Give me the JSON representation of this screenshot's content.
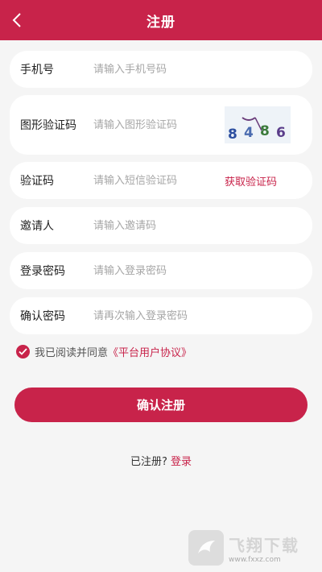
{
  "header": {
    "title": "注册"
  },
  "form": {
    "phone": {
      "label": "手机号",
      "placeholder": "请输入手机号码",
      "value": ""
    },
    "captcha": {
      "label": "图形验证码",
      "placeholder": "请输入图形验证码",
      "value": "",
      "image_text": "8486"
    },
    "sms_code": {
      "label": "验证码",
      "placeholder": "请输入短信验证码",
      "value": "",
      "action": "获取验证码"
    },
    "inviter": {
      "label": "邀请人",
      "placeholder": "请输入邀请码",
      "value": ""
    },
    "password": {
      "label": "登录密码",
      "placeholder": "请输入登录密码",
      "value": ""
    },
    "confirm_password": {
      "label": "确认密码",
      "placeholder": "请再次输入登录密码",
      "value": ""
    }
  },
  "agreement": {
    "checked": true,
    "text": "我已阅读并同意",
    "link": "《平台用户协议》"
  },
  "submit_label": "确认注册",
  "login_prompt": {
    "question": "已注册?",
    "link": "登录"
  },
  "watermark": {
    "cn": "飞翔下载",
    "url": "www.fxxz.com"
  },
  "colors": {
    "accent": "#c8234a",
    "background": "#f5f5f5"
  }
}
